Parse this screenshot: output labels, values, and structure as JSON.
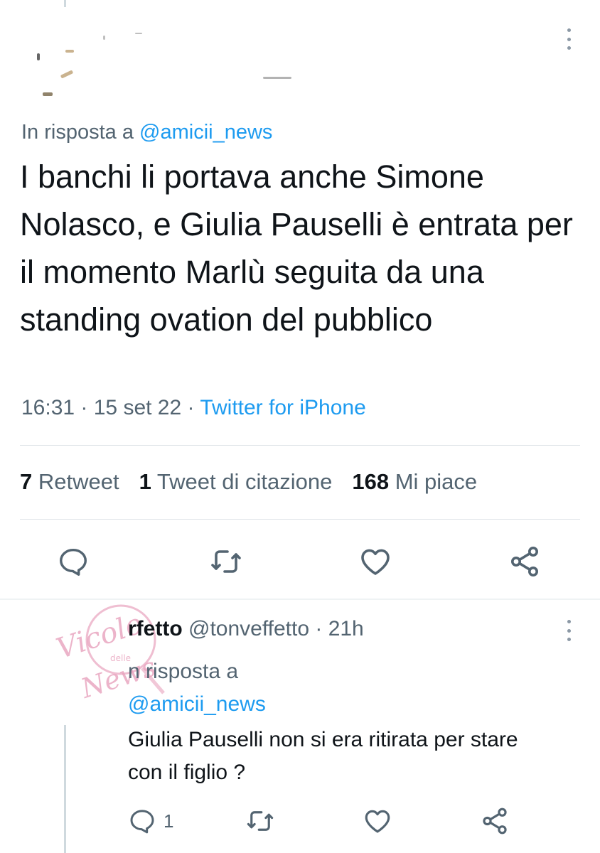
{
  "main_tweet": {
    "reply_prefix": "In risposta a",
    "reply_mention": "@amicii_news",
    "text": "I banchi li portava anche Simone Nolasco, e Giulia Pauselli è entrata per il momento Marlù seguita da una standing ovation del pubblico",
    "time": "16:31",
    "date": "15 set 22",
    "source": "Twitter for iPhone",
    "stats": {
      "retweet_count": "7",
      "retweet_label": "Retweet",
      "quote_count": "1",
      "quote_label": "Tweet di citazione",
      "like_count": "168",
      "like_label": "Mi piace"
    },
    "icons": [
      "reply-icon",
      "retweet-icon",
      "like-icon",
      "share-icon"
    ]
  },
  "reply_tweet": {
    "author_name_partial": "rfetto",
    "handle": "@tonveffetto",
    "time_ago": "21h",
    "reply_prefix": "n risposta a",
    "reply_mention": "@amicii_news",
    "text": "Giulia Pauselli non si era ritirata per stare con il figlio ?",
    "reply_count": "1",
    "icons": [
      "reply-icon",
      "retweet-icon",
      "like-icon",
      "share-icon"
    ]
  },
  "watermark": {
    "line1": "Vicolo",
    "line2": "delle",
    "line3": "News",
    "color": "#e8a2bd"
  },
  "colors": {
    "accent": "#1d9bf0",
    "secondary_text": "#536471",
    "primary_text": "#0f1419"
  }
}
